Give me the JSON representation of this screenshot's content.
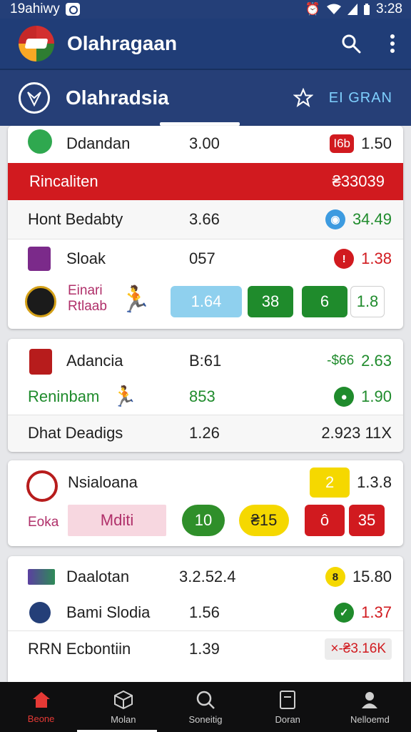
{
  "status": {
    "left_text": "19ahiwy",
    "time": "3:28"
  },
  "appbar": {
    "title": "Olahragaan"
  },
  "subbar": {
    "title": "Olahradsia",
    "action_label": "EI GRAN"
  },
  "card1": {
    "row1": {
      "name": "Ddandan",
      "value": "3.00",
      "chip": "I6b",
      "right_value": "1.50"
    },
    "band": {
      "label": "Rincaliten",
      "right_value": "₴33039"
    },
    "row2": {
      "name": "Hont Bedabty",
      "value": "3.66",
      "right_value": "34.49"
    },
    "row3": {
      "name": "Sloak",
      "value": "057",
      "right_value": "1.38"
    },
    "row4": {
      "name_top": "Einari",
      "name_bottom": "Rtlaab",
      "pill1": "1.64",
      "pill2": "38",
      "pill3": "6",
      "pill4": "1.8"
    }
  },
  "card2": {
    "row1": {
      "name": "Adancia",
      "value": "B:61",
      "right_prefix": "-$66",
      "right_value": "2.63"
    },
    "row2": {
      "name": "Reninbam",
      "value": "853",
      "right_value": "1.90"
    },
    "row3": {
      "name": "Dhat Deadigs",
      "value": "1.26",
      "right_value": "2.923 11X"
    }
  },
  "card3": {
    "row1": {
      "name": "Nsialoana",
      "badge": "2",
      "right_value": "1.3.8"
    },
    "row2": {
      "name": "Eoka",
      "box_label": "Mditi",
      "pill1": "10",
      "pill2": "₴15",
      "pill3": "ô",
      "pill4": "35"
    }
  },
  "card4": {
    "row1": {
      "name": "Daalotan",
      "value": "3.2.52.4",
      "right_value": "15.80"
    },
    "row2": {
      "name": "Bami Slodia",
      "value": "1.56",
      "right_value": "1.37"
    },
    "row3": {
      "name": "RRN Ecbontiin",
      "value": "1.39",
      "right_value": "×-₴3.16K"
    }
  },
  "bottomnav": [
    {
      "label": "Beone",
      "icon": "home-icon"
    },
    {
      "label": "Molan",
      "icon": "cube-icon"
    },
    {
      "label": "Soneitig",
      "icon": "search-icon"
    },
    {
      "label": "Doran",
      "icon": "document-icon"
    },
    {
      "label": "Nelloemd",
      "icon": "profile-icon"
    }
  ],
  "colors": {
    "navy": "#203d77",
    "red": "#d11a1f",
    "green": "#1f8b2c",
    "yellow": "#f5d800",
    "light_blue": "#8fd0ee"
  }
}
